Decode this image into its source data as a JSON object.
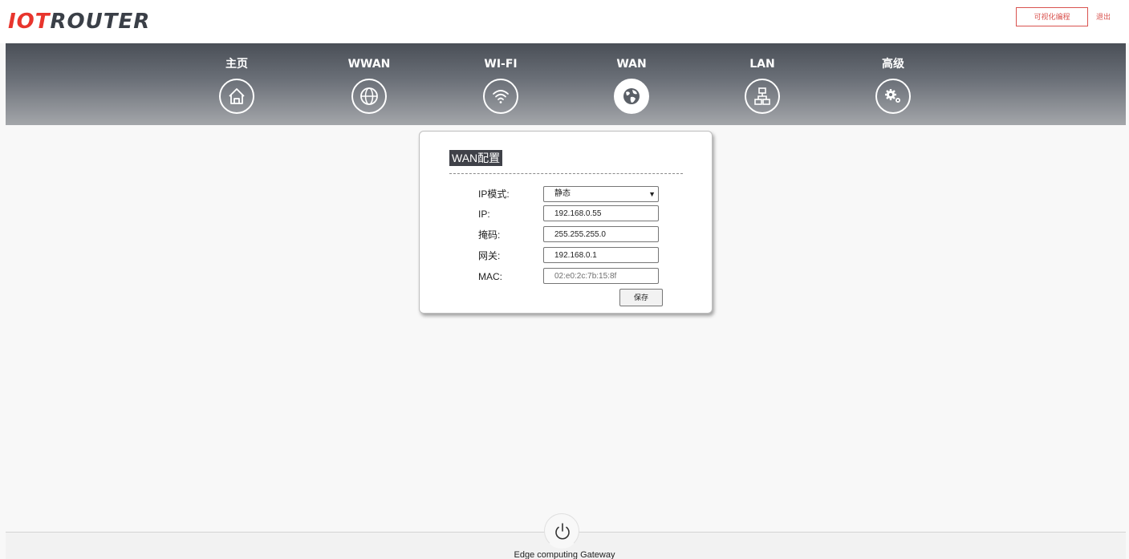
{
  "header": {
    "logo_part1": "IOT",
    "logo_part2": "ROUTER",
    "visual_programming_label": "可视化编程",
    "logout_label": "退出"
  },
  "nav": {
    "items": [
      {
        "label": "主页",
        "icon": "home-icon"
      },
      {
        "label": "WWAN",
        "icon": "globe-icon"
      },
      {
        "label": "WI-FI",
        "icon": "wifi-icon"
      },
      {
        "label": "WAN",
        "icon": "earth-icon",
        "active": true
      },
      {
        "label": "LAN",
        "icon": "network-icon"
      },
      {
        "label": "高级",
        "icon": "gears-icon"
      }
    ]
  },
  "panel": {
    "title": "WAN配置",
    "fields": {
      "ip_mode": {
        "label": "IP模式:",
        "value": "静态"
      },
      "ip": {
        "label": "IP:",
        "value": "192.168.0.55"
      },
      "mask": {
        "label": "掩码:",
        "value": "255.255.255.0"
      },
      "gateway": {
        "label": "网关:",
        "value": "192.168.0.1"
      },
      "mac": {
        "label": "MAC:",
        "value": "02:e0:2c:7b:15:8f"
      }
    },
    "save_label": "保存"
  },
  "footer": {
    "text": "Edge computing Gateway",
    "power_icon": "power-icon"
  },
  "colors": {
    "accent": "#e8352d",
    "logo_dark": "#3a3f47",
    "button_red": "#d9534f",
    "nav_top": "#4a4f57",
    "nav_bottom": "#a3a6aa"
  }
}
